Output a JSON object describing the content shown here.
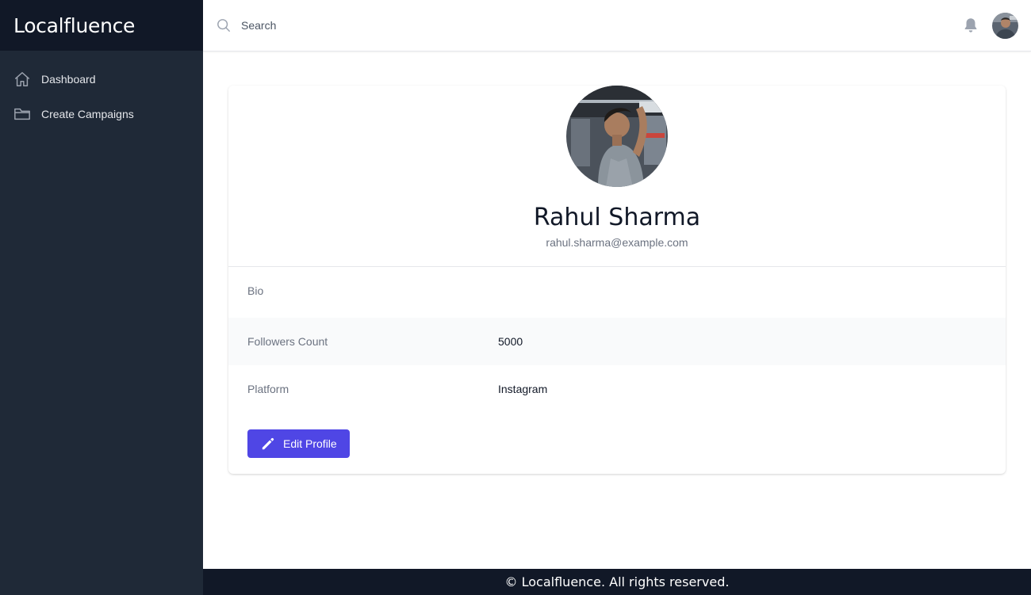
{
  "app": {
    "name": "Localfluence"
  },
  "sidebar": {
    "items": [
      {
        "label": "Dashboard",
        "icon": "home-icon"
      },
      {
        "label": "Create Campaigns",
        "icon": "folder-icon"
      }
    ]
  },
  "header": {
    "search": {
      "placeholder": "Search",
      "value": ""
    },
    "notifications_icon": "bell-icon",
    "avatar_icon": "user-avatar"
  },
  "profile": {
    "name": "Rahul Sharma",
    "email": "rahul.sharma@example.com",
    "fields": [
      {
        "label": "Bio",
        "value": ""
      },
      {
        "label": "Followers Count",
        "value": "5000"
      },
      {
        "label": "Platform",
        "value": "Instagram"
      }
    ],
    "edit_label": "Edit Profile"
  },
  "footer": {
    "text": "© Localfluence. All rights reserved."
  },
  "colors": {
    "sidebar_bg": "#1f2937",
    "brand_bg": "#111827",
    "accent": "#4f46e5",
    "footer_bg": "#111827"
  }
}
